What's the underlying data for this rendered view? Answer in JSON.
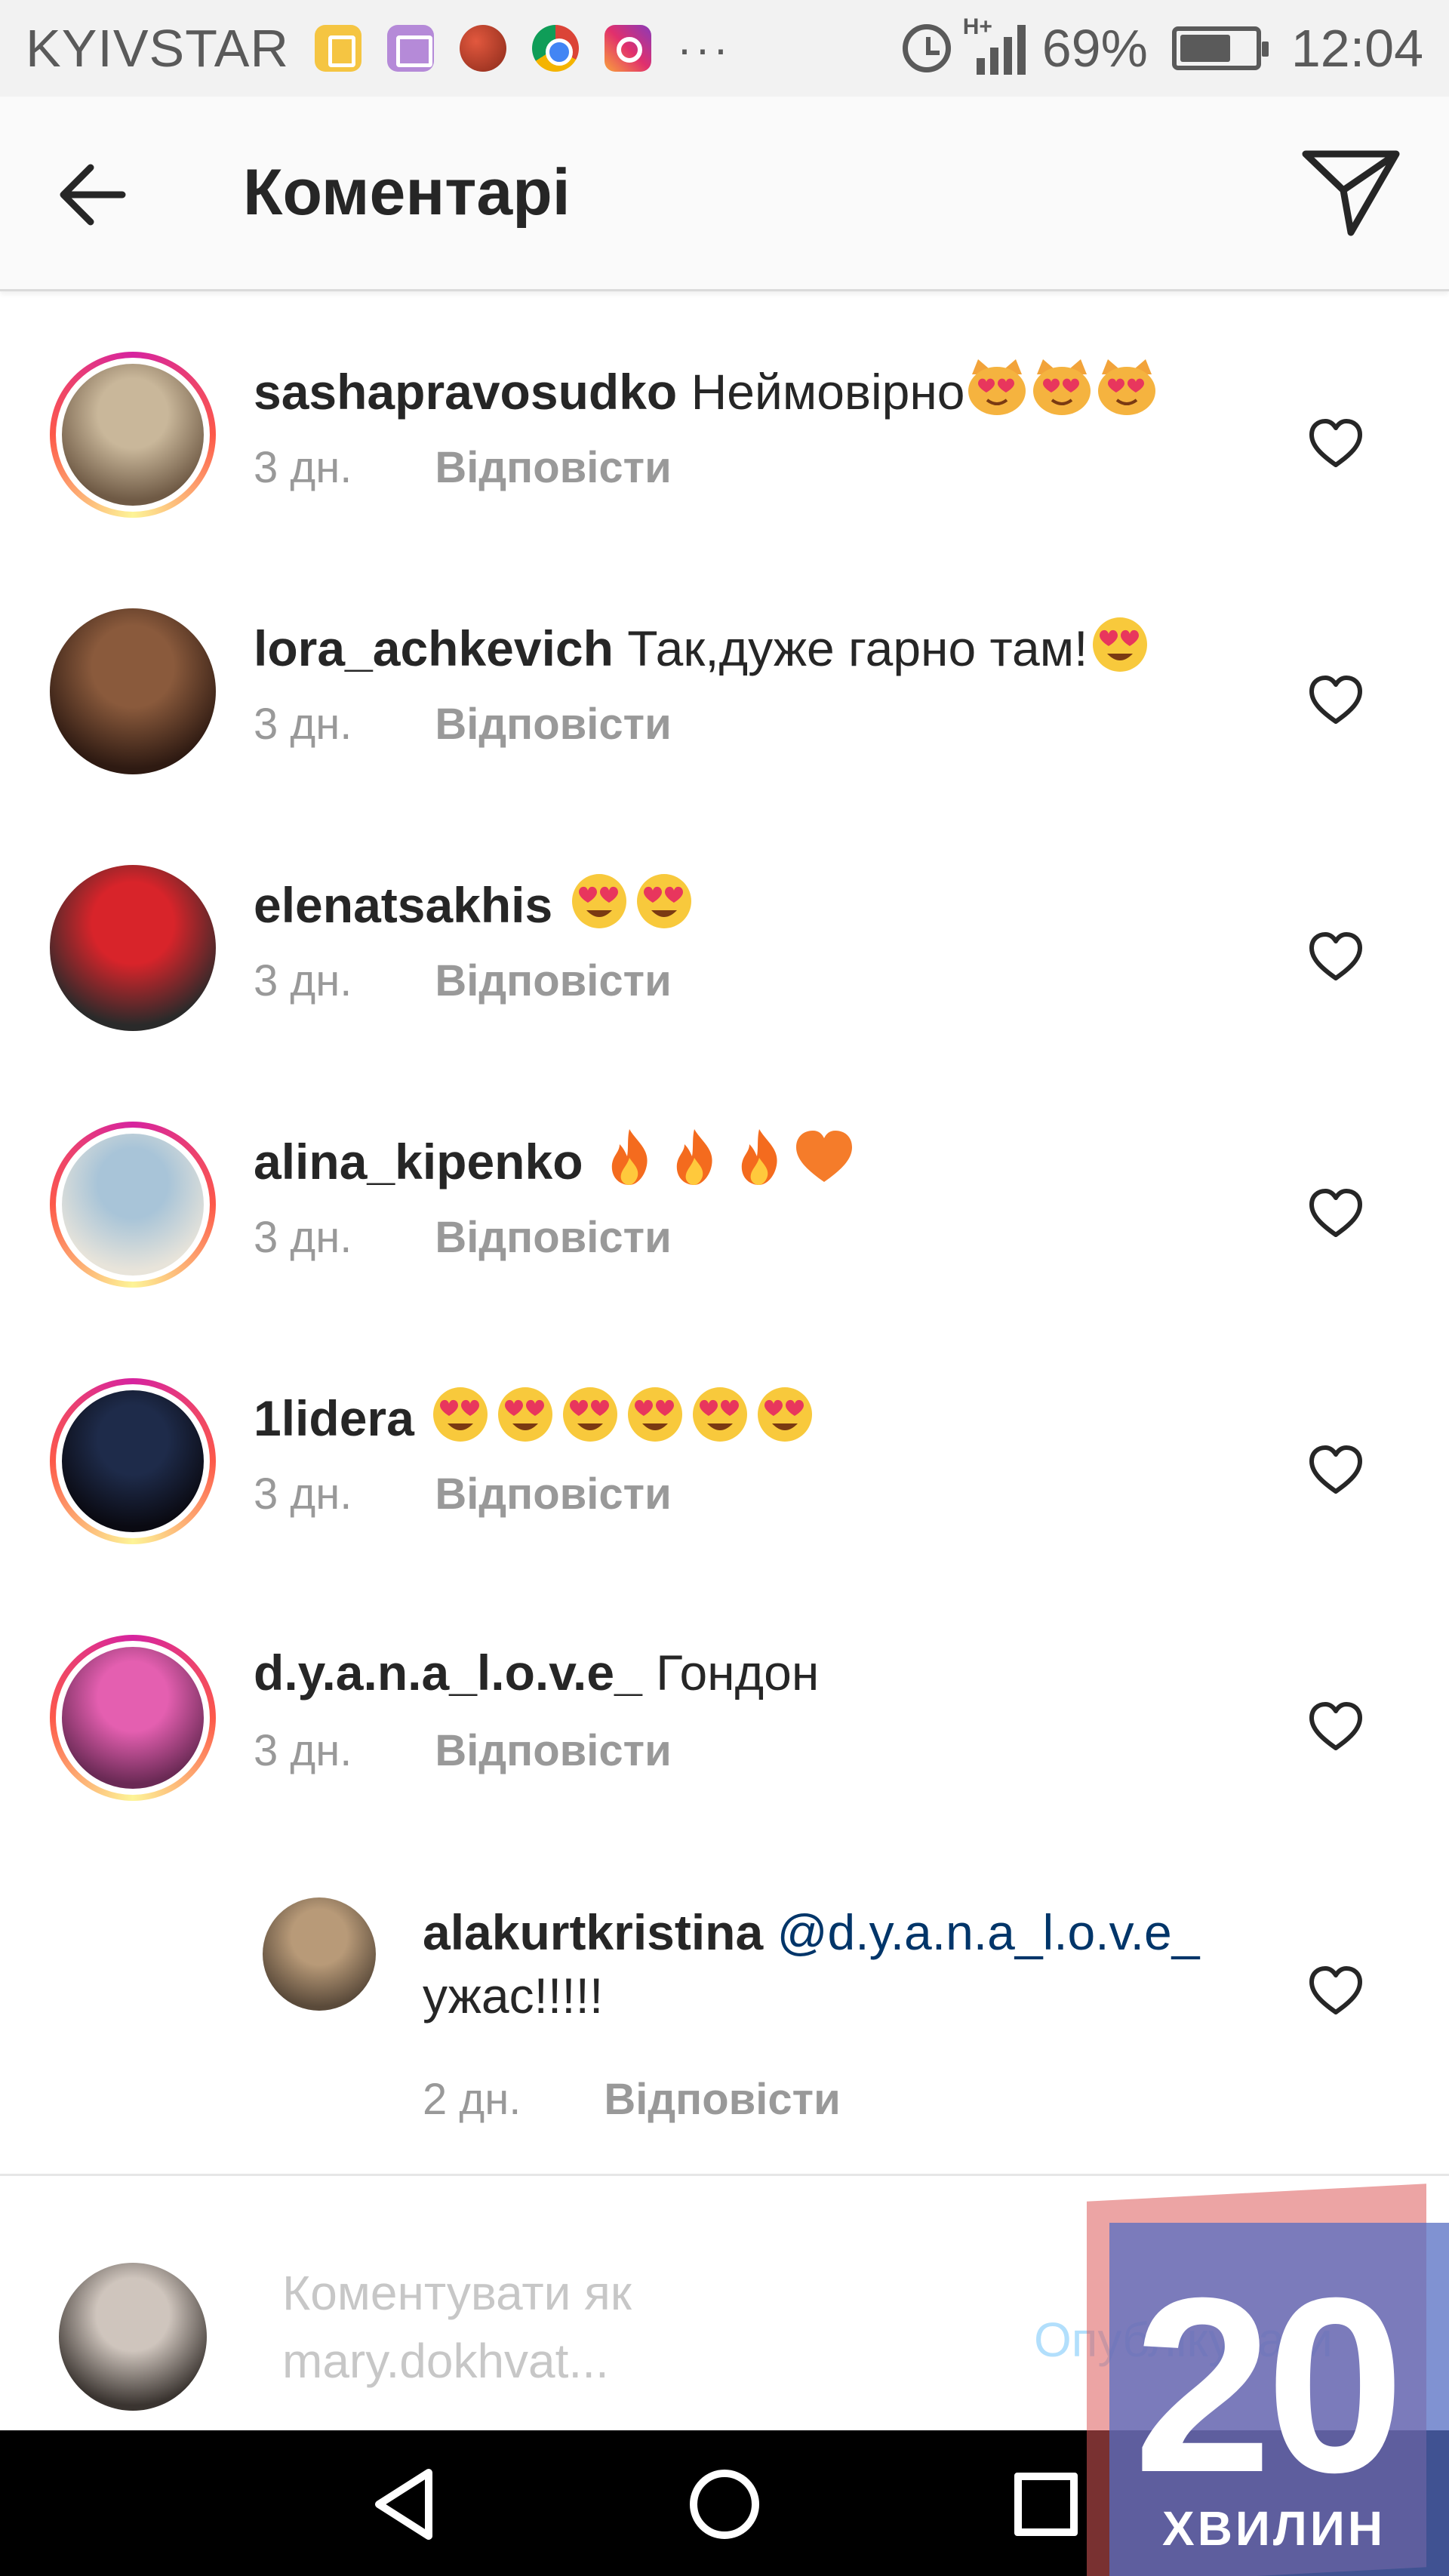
{
  "status_bar": {
    "carrier": "KYIVSTAR",
    "more": "···",
    "network": "H+",
    "battery": "69%",
    "battery_level": 0.69,
    "time": "12:04",
    "icons": [
      "note-icon",
      "gallery-icon",
      "ball-icon",
      "chrome-icon",
      "instagram-icon",
      "alarm-icon",
      "signal-icon",
      "battery-icon"
    ]
  },
  "header": {
    "title": "Коментарі",
    "back_icon": "arrow-left-icon",
    "direct_icon": "paper-plane-icon"
  },
  "comments": [
    {
      "username": "sashapravosudko",
      "text": "Неймовірно",
      "emoji": [
        "heart-eyes-cat-icon",
        "heart-eyes-cat-icon",
        "heart-eyes-cat-icon"
      ],
      "time": "3 дн.",
      "reply": "Відповісти",
      "story_ring": true,
      "avatar_colors": [
        "#c9b79a",
        "#6f5a45"
      ]
    },
    {
      "username": "lora_achkevich",
      "text": "Так,дуже гарно там!",
      "emoji": [
        "heart-eyes-icon"
      ],
      "time": "3 дн.",
      "reply": "Відповісти",
      "story_ring": false,
      "avatar_colors": [
        "#8a5a3c",
        "#2e1a12"
      ]
    },
    {
      "username": "elenatsakhis",
      "text": "",
      "emoji": [
        "heart-eyes-icon",
        "heart-eyes-icon"
      ],
      "time": "3 дн.",
      "reply": "Відповісти",
      "story_ring": false,
      "avatar_colors": [
        "#d8242a",
        "#2a2a2a"
      ]
    },
    {
      "username": "alina_kipenko",
      "text": "",
      "emoji": [
        "fire-icon",
        "fire-icon",
        "fire-icon",
        "orange-heart-icon"
      ],
      "time": "3 дн.",
      "reply": "Відповісти",
      "story_ring": true,
      "avatar_colors": [
        "#a8c4d8",
        "#e8e4da"
      ]
    },
    {
      "username": "1lidera",
      "text": "",
      "emoji": [
        "heart-eyes-icon",
        "heart-eyes-icon",
        "heart-eyes-icon",
        "heart-eyes-icon",
        "heart-eyes-icon",
        "heart-eyes-icon"
      ],
      "time": "3 дн.",
      "reply": "Відповісти",
      "story_ring": true,
      "avatar_colors": [
        "#1e2b4a",
        "#0a0a12"
      ]
    },
    {
      "username": "d.y.a.n.a_l.o.v.e_",
      "text": "Гондон",
      "emoji": [],
      "time": "3 дн.",
      "reply": "Відповісти",
      "story_ring": true,
      "avatar_colors": [
        "#e45fb0",
        "#6a2a55"
      ]
    },
    {
      "username": "alakurtkristina",
      "mention": "@d.y.a.n.a_l.o.v.e_",
      "text": "ужас!!!!!",
      "emoji": [],
      "time": "2 дн.",
      "reply": "Відповісти",
      "story_ring": false,
      "is_reply": true,
      "avatar_colors": [
        "#b89a78",
        "#5a4a3a"
      ]
    }
  ],
  "input_bar": {
    "placeholder_line1": "Коментувати як",
    "placeholder_line2": "mary.dokhvat...",
    "publish": "Опублікувати",
    "avatar_colors": [
      "#cfc5bd",
      "#3a3430"
    ]
  },
  "nav_bar": {
    "icons": [
      "nav-back-icon",
      "nav-home-icon",
      "nav-recent-icon"
    ]
  },
  "watermark": {
    "number": "20",
    "word": "ХВИЛИН"
  },
  "colors": {
    "text": "#262626",
    "secondary": "#999999",
    "mention": "#003569",
    "publish_disabled": "#b2dffc",
    "placeholder": "#c7c7c7"
  }
}
